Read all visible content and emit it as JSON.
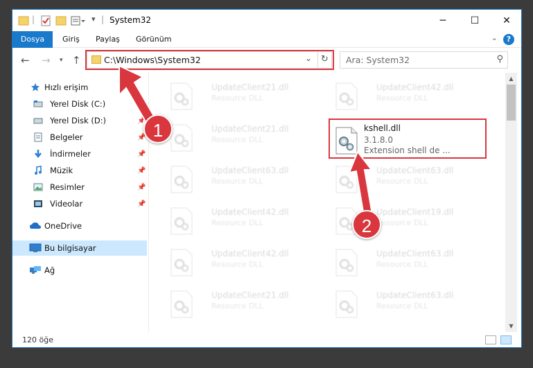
{
  "window": {
    "title": "System32"
  },
  "ribbon": {
    "tabs": [
      "Dosya",
      "Giriş",
      "Paylaş",
      "Görünüm"
    ],
    "help_label": "?"
  },
  "nav": {
    "address": "C:\\Windows\\System32",
    "search_placeholder": "Ara: System32"
  },
  "sidebar": {
    "items": [
      {
        "label": "Hızlı erişim",
        "icon": "star-icon",
        "pinned": false
      },
      {
        "label": "Yerel Disk (C:)",
        "icon": "drive-icon",
        "pinned": true
      },
      {
        "label": "Yerel Disk (D:)",
        "icon": "drive-icon",
        "pinned": true
      },
      {
        "label": "Belgeler",
        "icon": "documents-icon",
        "pinned": true
      },
      {
        "label": "İndirmeler",
        "icon": "download-icon",
        "pinned": true
      },
      {
        "label": "Müzik",
        "icon": "music-icon",
        "pinned": true
      },
      {
        "label": "Resimler",
        "icon": "pictures-icon",
        "pinned": true
      },
      {
        "label": "Videolar",
        "icon": "videos-icon",
        "pinned": true
      },
      {
        "label": "OneDrive",
        "icon": "cloud-icon",
        "pinned": false
      },
      {
        "label": "Bu bilgisayar",
        "icon": "computer-icon",
        "pinned": false,
        "selected": true
      },
      {
        "label": "Ağ",
        "icon": "network-icon",
        "pinned": false
      }
    ]
  },
  "files": {
    "left_column": [
      {
        "name": "UpdateClient21.dll",
        "desc": "Resource DLL"
      },
      {
        "name": "UpdateClient21.dll",
        "desc": "Resource DLL"
      },
      {
        "name": "UpdateClient63.dll",
        "desc": "Resource DLL"
      },
      {
        "name": "UpdateClient42.dll",
        "desc": "Resource DLL"
      },
      {
        "name": "UpdateClient42.dll",
        "desc": "Resource DLL"
      },
      {
        "name": "UpdateClient21.dll",
        "desc": "Resource DLL"
      }
    ],
    "right_column": [
      {
        "name": "UpdateClient42.dll",
        "desc": "Resource DLL"
      },
      {
        "name": "UpdateClient63.dll",
        "desc": "Resource DLL"
      },
      {
        "name": "UpdateClient19.dll",
        "desc": "Resource DLL"
      },
      {
        "name": "UpdateClient63.dll",
        "desc": "Resource DLL"
      },
      {
        "name": "UpdateClient63.dll",
        "desc": "Resource DLL"
      }
    ],
    "highlighted": {
      "name": "kshell.dll",
      "version": "3.1.8.0",
      "desc": "Extension shell de ..."
    }
  },
  "status": {
    "count": "120 öğe"
  },
  "annotations": {
    "step1": "1",
    "step2": "2",
    "color": "#d9363e"
  }
}
